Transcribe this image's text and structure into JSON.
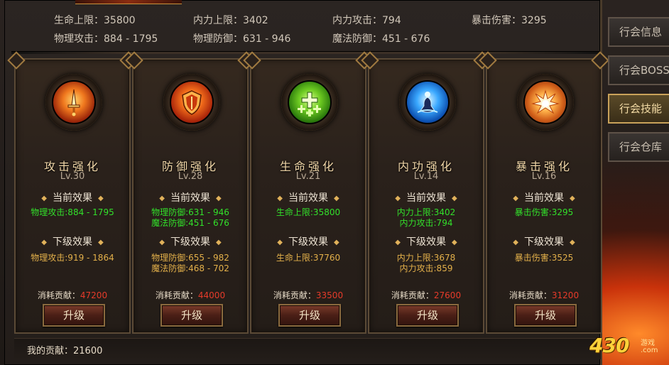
{
  "stats": [
    {
      "label": "生命上限",
      "value": "35800"
    },
    {
      "label": "内力上限",
      "value": "3402"
    },
    {
      "label": "内力攻击",
      "value": "794"
    },
    {
      "label": "暴击伤害",
      "value": "3295"
    },
    {
      "label": "物理攻击",
      "value": "884 - 1795"
    },
    {
      "label": "物理防御",
      "value": "631 - 946"
    },
    {
      "label": "魔法防御",
      "value": "451 - 676"
    }
  ],
  "stats_text": [
    "生命上限：35800",
    "内力上限：3402",
    "内力攻击：794",
    "暴击伤害：3295",
    "物理攻击：884 - 1795",
    "物理防御：631 - 946",
    "魔法防御：451 - 676"
  ],
  "labels": {
    "current_effect": "当前效果",
    "next_effect": "下级效果",
    "cost_label": "消耗贡献：",
    "upgrade": "升级",
    "my_contribution": "我的贡献：21600"
  },
  "cards": [
    {
      "title": "攻击强化",
      "level": "Lv.30",
      "icon": "flaming-sword-icon",
      "current": [
        "物理攻击:884 - 1795"
      ],
      "next": [
        "物理攻击:919 - 1864"
      ],
      "cost": "47200"
    },
    {
      "title": "防御强化",
      "level": "Lv.28",
      "icon": "flaming-shield-icon",
      "current": [
        "物理防御:631 - 946",
        "魔法防御:451 - 676"
      ],
      "next": [
        "物理防御:655 - 982",
        "魔法防御:468 - 702"
      ],
      "cost": "44000"
    },
    {
      "title": "生命强化",
      "level": "Lv.21",
      "icon": "green-cross-icon",
      "current": [
        "生命上限:35800"
      ],
      "next": [
        "生命上限:37760"
      ],
      "cost": "33500"
    },
    {
      "title": "内功强化",
      "level": "Lv.14",
      "icon": "meditation-icon",
      "current": [
        "内力上限:3402",
        "内力攻击:794"
      ],
      "next": [
        "内力上限:3678",
        "内力攻击:859"
      ],
      "cost": "27600"
    },
    {
      "title": "暴击强化",
      "level": "Lv.16",
      "icon": "explosion-icon",
      "current": [
        "暴击伤害:3295"
      ],
      "next": [
        "暴击伤害:3525"
      ],
      "cost": "31200"
    }
  ],
  "side_tabs": [
    "行会信息",
    "行会BOSS",
    "行会技能",
    "行会仓库"
  ],
  "active_tab": "行会技能",
  "watermark": {
    "logo": "430",
    "line1": "游戏",
    "line2": ".com"
  },
  "colors": {
    "current_effect": "#32e02a",
    "next_effect": "#e3b04a",
    "cost_amount": "#e63b2a",
    "title": "#f2d7a8"
  }
}
